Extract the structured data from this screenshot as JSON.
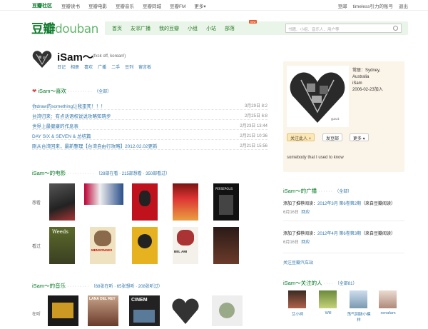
{
  "topbar": {
    "brand": "豆瓣社区",
    "nav": [
      "豆瓣读书",
      "豆瓣电影",
      "豆瓣音乐",
      "豆瓣同城",
      "豆瓣FM",
      "更多▾"
    ],
    "right": [
      "豆邮",
      "timeless引力的账号",
      "退出"
    ]
  },
  "header": {
    "logo_cn": "豆瓣",
    "logo_en": "douban",
    "nav": [
      "首页",
      "友邻广播",
      "我的豆瓣",
      "小组",
      "小站",
      "部落"
    ],
    "nav_badge": "new",
    "search_placeholder": "书籍、小组、音乐人、用户等"
  },
  "profile": {
    "name": "iSam～",
    "subtitle": "(fxck off, korean!)",
    "links": [
      "日记",
      "相册",
      "喜欢",
      "广播",
      "二手",
      "豆列",
      "留言板"
    ]
  },
  "likes": {
    "title": "iSam～喜欢",
    "meta": "（全部）",
    "items": [
      {
        "title": "你draw的something让我歪死！！！",
        "date": "3月29日 8:2"
      },
      {
        "title": "台湾归来：有点话语权说说攻略知晓步",
        "date": "2月25日 6:8"
      },
      {
        "title": "世界上最健康的作息表",
        "date": "2月23日 13:44"
      },
      {
        "title": "DAY SIX & SEVEN & 总结篇",
        "date": "2月21日 10:36"
      },
      {
        "title": "刚从台湾回来，最新整理【台湾自由行攻略】2012.02.02更新",
        "date": "2月21日 15:56"
      }
    ]
  },
  "movies": {
    "title": "iSam～的电影",
    "meta": "（28部在看 · 215部想看 · 350部看过）",
    "row_want": "想看",
    "row_seen": "看过",
    "want": [
      "poster-1",
      "poster-2",
      "poster-3",
      "poster-4",
      "persepolis"
    ],
    "seen": [
      "weeds",
      "mensonges",
      "the-bang-bang",
      "bel-ami",
      "movie-5"
    ]
  },
  "music": {
    "title": "iSam～的音乐",
    "meta": "（68张在听 · 65张想听 · 208张听过）",
    "row_now": "在听"
  },
  "sidebar": {
    "info": [
      "常居：Sydney,",
      "Australia",
      "iSam",
      "2006-02-23加入"
    ],
    "follow_btn": "关注此人 +",
    "mail_btn": "发豆邮",
    "more_btn": "更多 ▾",
    "signature": "somebody that I used to know"
  },
  "broadcast": {
    "title": "iSam～的广播",
    "meta": "（全部）",
    "items": [
      {
        "prefix": "添加了推荐阅读：",
        "link": "2012年3月 第6卷第2期",
        "suffix": "（来自豆瓣阅读）",
        "date": "6月16日",
        "reply": "回应"
      },
      {
        "prefix": "添加了推荐阅读：",
        "link": "2012年4月 第6卷第3期",
        "suffix": "（来自豆瓣阅读）",
        "date": "6月16日",
        "reply": "回应"
      }
    ],
    "follow_car": "关注豆瓣汽车站"
  },
  "following": {
    "title": "iSam～关注的人",
    "meta": "（全部81）",
    "people": [
      "艾小柯",
      "Will",
      "荡气回肠小模样",
      "xenafam"
    ]
  },
  "colors": {
    "accent_green": "#0f7a2c",
    "link_blue": "#37a",
    "sidebar_bg": "#fbf4e8"
  }
}
